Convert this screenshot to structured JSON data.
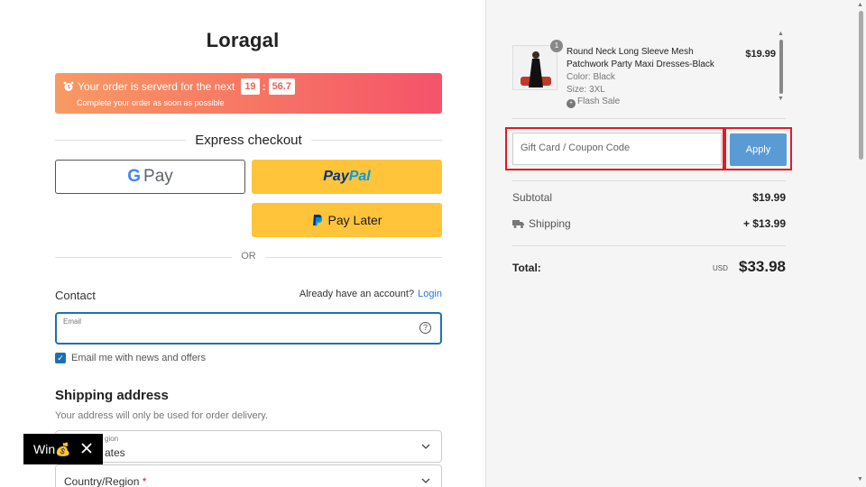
{
  "brand": {
    "logo": "Loragal"
  },
  "timer": {
    "prefix": "Your order is serverd for the next",
    "minutes": "19",
    "seconds": "56.7",
    "note": "Complete your order as soon as possible"
  },
  "express": {
    "title": "Express checkout",
    "gpay_g": "G",
    "gpay_label": "Pay",
    "paypal_a": "Pay",
    "paypal_b": "Pal",
    "paylater_label": "Pay Later",
    "or": "OR"
  },
  "contact": {
    "title": "Contact",
    "have_account": "Already have an account?",
    "login": "Login",
    "email_label": "Email",
    "email_value": "",
    "newsletter": "Email me with news and offers",
    "newsletter_checked": true
  },
  "shipping": {
    "title": "Shipping address",
    "subtitle": "Your address will only be used for order delivery.",
    "region_label_partial": "gion",
    "region_value_partial": "ates",
    "country_label": "Country/Region",
    "required_mark": "*"
  },
  "popup": {
    "label": "Win",
    "emoji": "💰"
  },
  "cart": {
    "items": [
      {
        "qty": "1",
        "name": "Round Neck Long Sleeve Mesh Patchwork Party Maxi Dresses-Black",
        "color": "Color: Black",
        "size": "Size: 3XL",
        "tag": "Flash Sale",
        "price": "$19.99"
      }
    ]
  },
  "coupon": {
    "placeholder": "Gift Card / Coupon Code",
    "apply": "Apply"
  },
  "summary": {
    "subtotal_label": "Subtotal",
    "subtotal": "$19.99",
    "shipping_label": "Shipping",
    "shipping": "+ $13.99",
    "total_label": "Total:",
    "currency": "USD",
    "total": "$33.98"
  },
  "colors": {
    "accent": "#1f6fb2",
    "apply": "#5b9bd5",
    "highlight": "#e01c24",
    "paypal_yellow": "#ffc439"
  }
}
